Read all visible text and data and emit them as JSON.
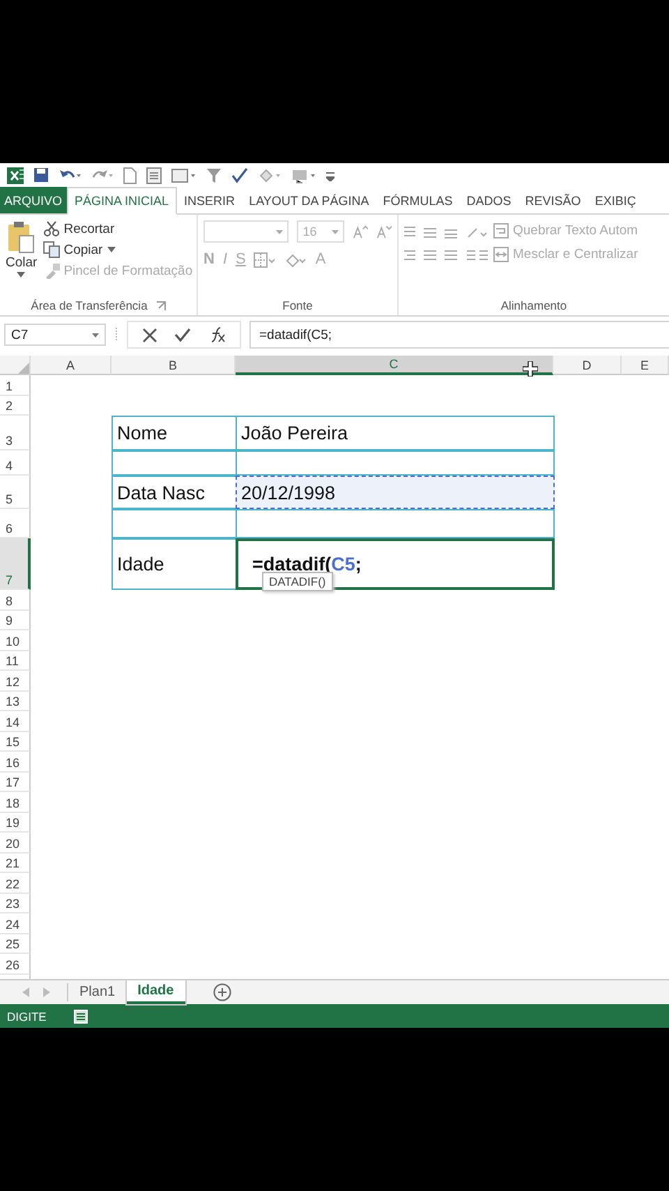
{
  "ribbon_tabs": [
    {
      "label": "ARQUIVO",
      "kind": "file",
      "selected": false
    },
    {
      "label": "PÁGINA INICIAL",
      "kind": "tab",
      "selected": true
    },
    {
      "label": "INSERIR",
      "kind": "tab",
      "selected": false
    },
    {
      "label": "LAYOUT DA PÁGINA",
      "kind": "tab",
      "selected": false
    },
    {
      "label": "FÓRMULAS",
      "kind": "tab",
      "selected": false
    },
    {
      "label": "DADOS",
      "kind": "tab",
      "selected": false
    },
    {
      "label": "REVISÃO",
      "kind": "tab",
      "selected": false
    },
    {
      "label": "EXIBIÇ",
      "kind": "tab",
      "selected": false
    }
  ],
  "ribbon": {
    "clipboard": {
      "label": "Área de Transferência",
      "paste": {
        "label": "Colar",
        "disabled": false
      },
      "items": [
        {
          "label": "Recortar",
          "kind": "cut",
          "disabled": false
        },
        {
          "label": "Copiar",
          "kind": "copy",
          "disabled": false
        },
        {
          "label": "Pincel de Formatação",
          "kind": "painter",
          "disabled": true
        }
      ]
    },
    "font": {
      "label": "Fonte",
      "size": "16",
      "bold": "N",
      "italic": "I",
      "underline": "S",
      "font_color_label": "A",
      "disabled": true
    },
    "alignment": {
      "label": "Alinhamento",
      "wrap": "Quebrar Texto Autom",
      "merge": "Mesclar e Centralizar",
      "disabled": true
    }
  },
  "formula_bar": {
    "name_box": "C7",
    "formula": "=datadif(C5;"
  },
  "columns": [
    {
      "label": "A",
      "selected": false
    },
    {
      "label": "B",
      "selected": false
    },
    {
      "label": "C",
      "selected": true
    },
    {
      "label": "D",
      "selected": false
    },
    {
      "label": "E",
      "selected": false
    }
  ],
  "rows": [
    {
      "number": "1",
      "selected": false
    },
    {
      "number": "2",
      "selected": false
    },
    {
      "number": "3",
      "selected": false,
      "B": {
        "text": "Nome",
        "selected": false,
        "referenced": false
      },
      "C": {
        "text": "João Pereira",
        "selected": false,
        "referenced": false
      }
    },
    {
      "number": "4",
      "selected": false
    },
    {
      "number": "5",
      "selected": false,
      "B": {
        "text": "Data Nasc",
        "selected": false,
        "referenced": false
      },
      "C": {
        "text": "20/12/1998",
        "selected": false,
        "referenced": true
      }
    },
    {
      "number": "6",
      "selected": false
    },
    {
      "number": "7",
      "selected": true,
      "B": {
        "text": "Idade",
        "selected": false,
        "referenced": false
      },
      "C": {
        "parts": [
          {
            "text": "=datadif(",
            "ref": false
          },
          {
            "text": "C5",
            "ref": true
          },
          {
            "text": ";",
            "ref": false
          }
        ],
        "selected": true,
        "referenced": false
      }
    },
    {
      "number": "8",
      "selected": false
    },
    {
      "number": "9",
      "selected": false
    },
    {
      "number": "10",
      "selected": false
    },
    {
      "number": "11",
      "selected": false
    },
    {
      "number": "12",
      "selected": false
    },
    {
      "number": "13",
      "selected": false
    },
    {
      "number": "14",
      "selected": false
    },
    {
      "number": "15",
      "selected": false
    },
    {
      "number": "16",
      "selected": false
    },
    {
      "number": "17",
      "selected": false
    },
    {
      "number": "18",
      "selected": false
    },
    {
      "number": "19",
      "selected": false
    },
    {
      "number": "20",
      "selected": false
    },
    {
      "number": "21",
      "selected": false
    },
    {
      "number": "22",
      "selected": false
    },
    {
      "number": "23",
      "selected": false
    },
    {
      "number": "24",
      "selected": false
    },
    {
      "number": "25",
      "selected": false
    },
    {
      "number": "26",
      "selected": false
    }
  ],
  "tooltip": "DATADIF()",
  "sheet_tabs": [
    {
      "label": "Plan1",
      "selected": false
    },
    {
      "label": "Idade",
      "selected": true
    }
  ],
  "status_bar": {
    "mode": "DIGITE"
  }
}
